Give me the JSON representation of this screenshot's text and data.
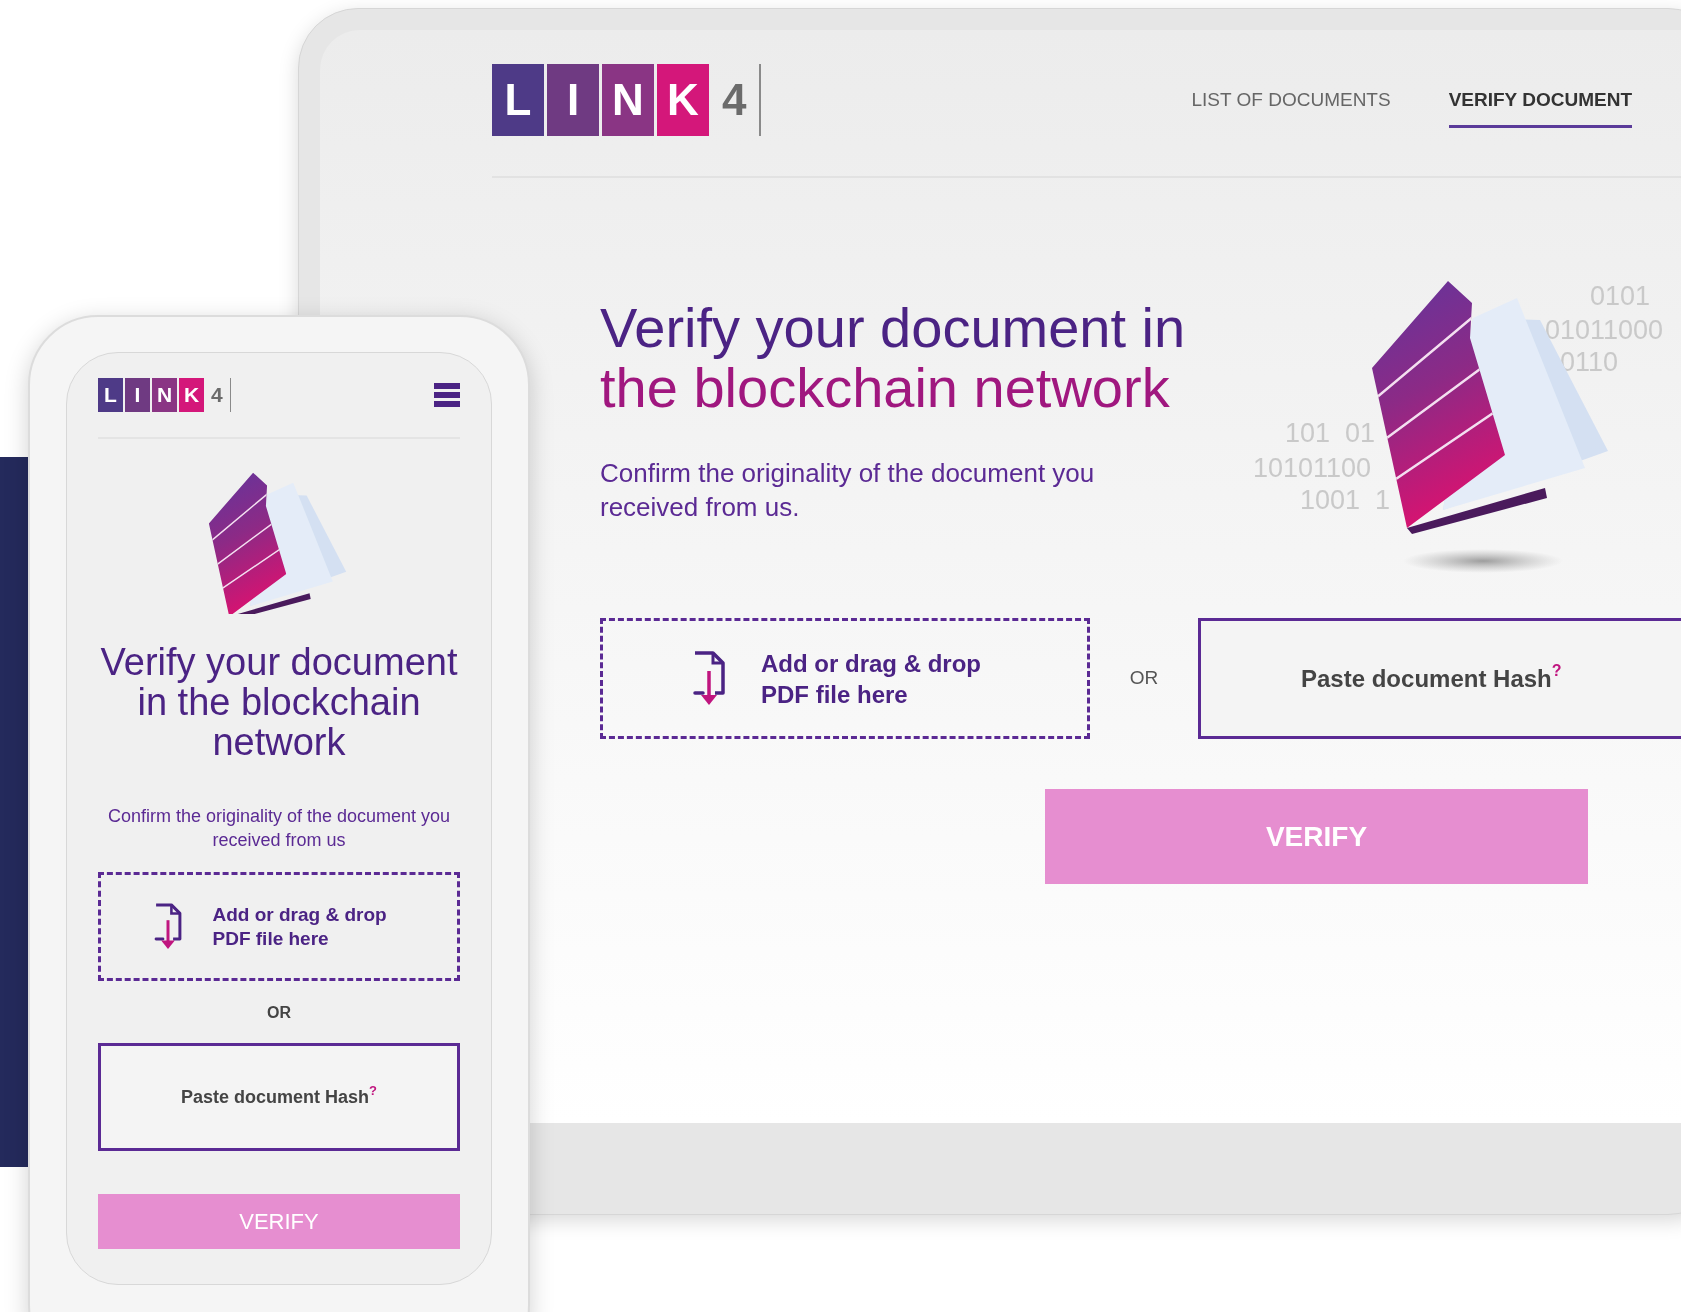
{
  "tablet": {
    "logo": {
      "letters": [
        "L",
        "I",
        "N",
        "K"
      ],
      "suffix": "4"
    },
    "nav": [
      {
        "label": "LIST OF DOCUMENTS",
        "selected": false
      },
      {
        "label": "VERIFY DOCUMENT",
        "selected": true
      }
    ],
    "title_lines": [
      "Verify your document in",
      "the blockchain network"
    ],
    "subtitle": "Confirm the originality of the document you received from us.",
    "binary_text": [
      "0101",
      "01011000",
      "0110",
      "101  01",
      "10101100",
      "1001  1"
    ],
    "drop_zone": "Add or drag & drop PDF file here",
    "or": "OR",
    "hash_box": "Paste document Hash$^{?}$",
    "verify_button": "VERIFY"
  },
  "phone": {
    "logo": {
      "letters": [
        "L",
        "I",
        "N",
        "K"
      ],
      "suffix": "4"
    },
    "title": "Verify your document in the blockchain network",
    "subtitle": "Confirm the originality of the document you received from us",
    "drop_zone": "Add or drag & drop PDF file here",
    "or": "OR",
    "hash_box": "Paste document Hash$^{?}$",
    "verify_button": "VERIFY"
  }
}
